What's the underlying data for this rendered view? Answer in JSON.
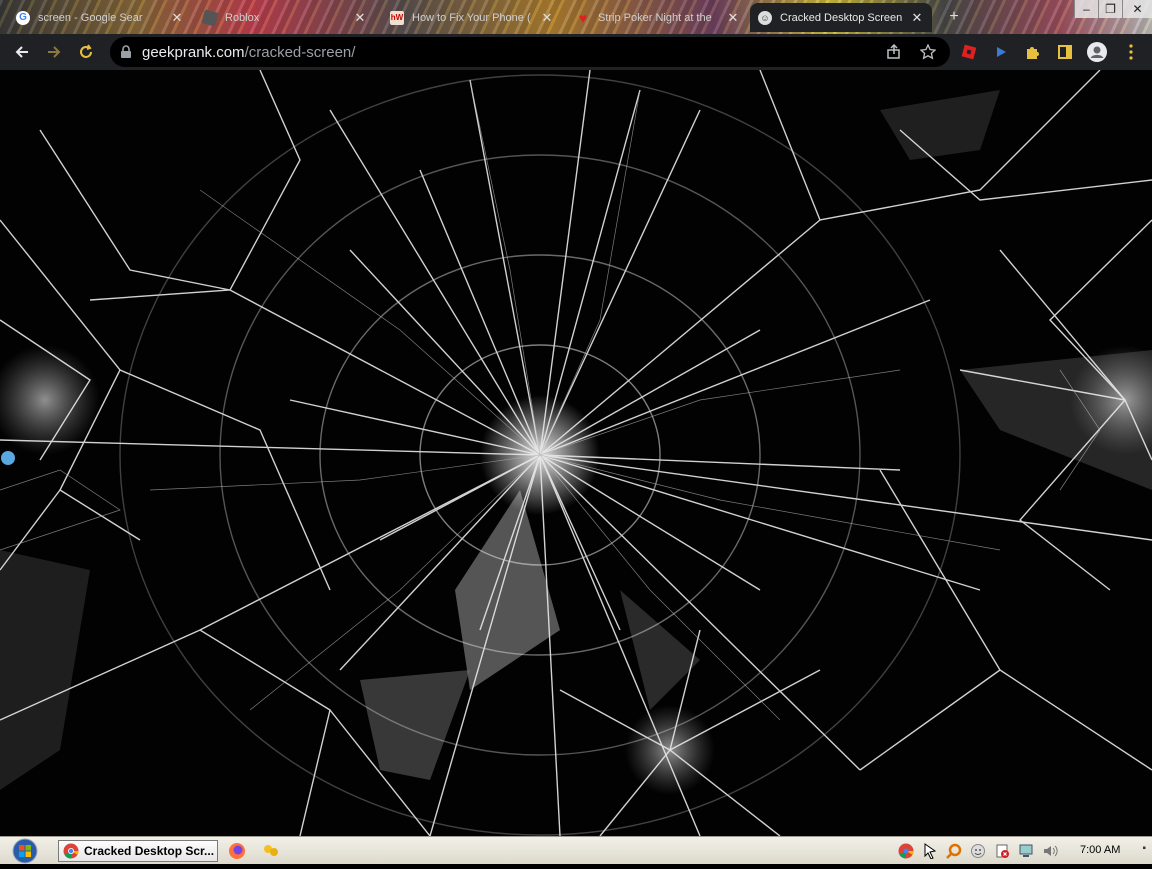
{
  "browser": {
    "tabs": [
      {
        "title": "screen - Google Sear",
        "favicon": "google-icon"
      },
      {
        "title": "Roblox",
        "favicon": "roblox-icon"
      },
      {
        "title": "How to Fix Your Phone (",
        "favicon": "wikihow-icon"
      },
      {
        "title": "Strip Poker Night at the",
        "favicon": "heart-icon"
      },
      {
        "title": "Cracked Desktop Screen",
        "favicon": "geekprank-icon",
        "active": true
      }
    ],
    "new_tab_label": "+",
    "window_controls": {
      "minimize": "–",
      "maximize": "❐",
      "close": "✕"
    },
    "address": {
      "domain": "geekprank.com",
      "path": "/cracked-screen/"
    }
  },
  "page": {
    "background": "cracked-glass-image"
  },
  "taskbar": {
    "start": "windows-start-orb",
    "task_button_label": "Cracked Desktop Scr...",
    "clock": "7:00 AM"
  },
  "colors": {
    "toolbar_bg": "#202124",
    "omnibox_bg": "#000000",
    "url_text": "#e8eaed",
    "url_path": "#9aa0a6",
    "taskbar_bg": "#ebe8de"
  }
}
